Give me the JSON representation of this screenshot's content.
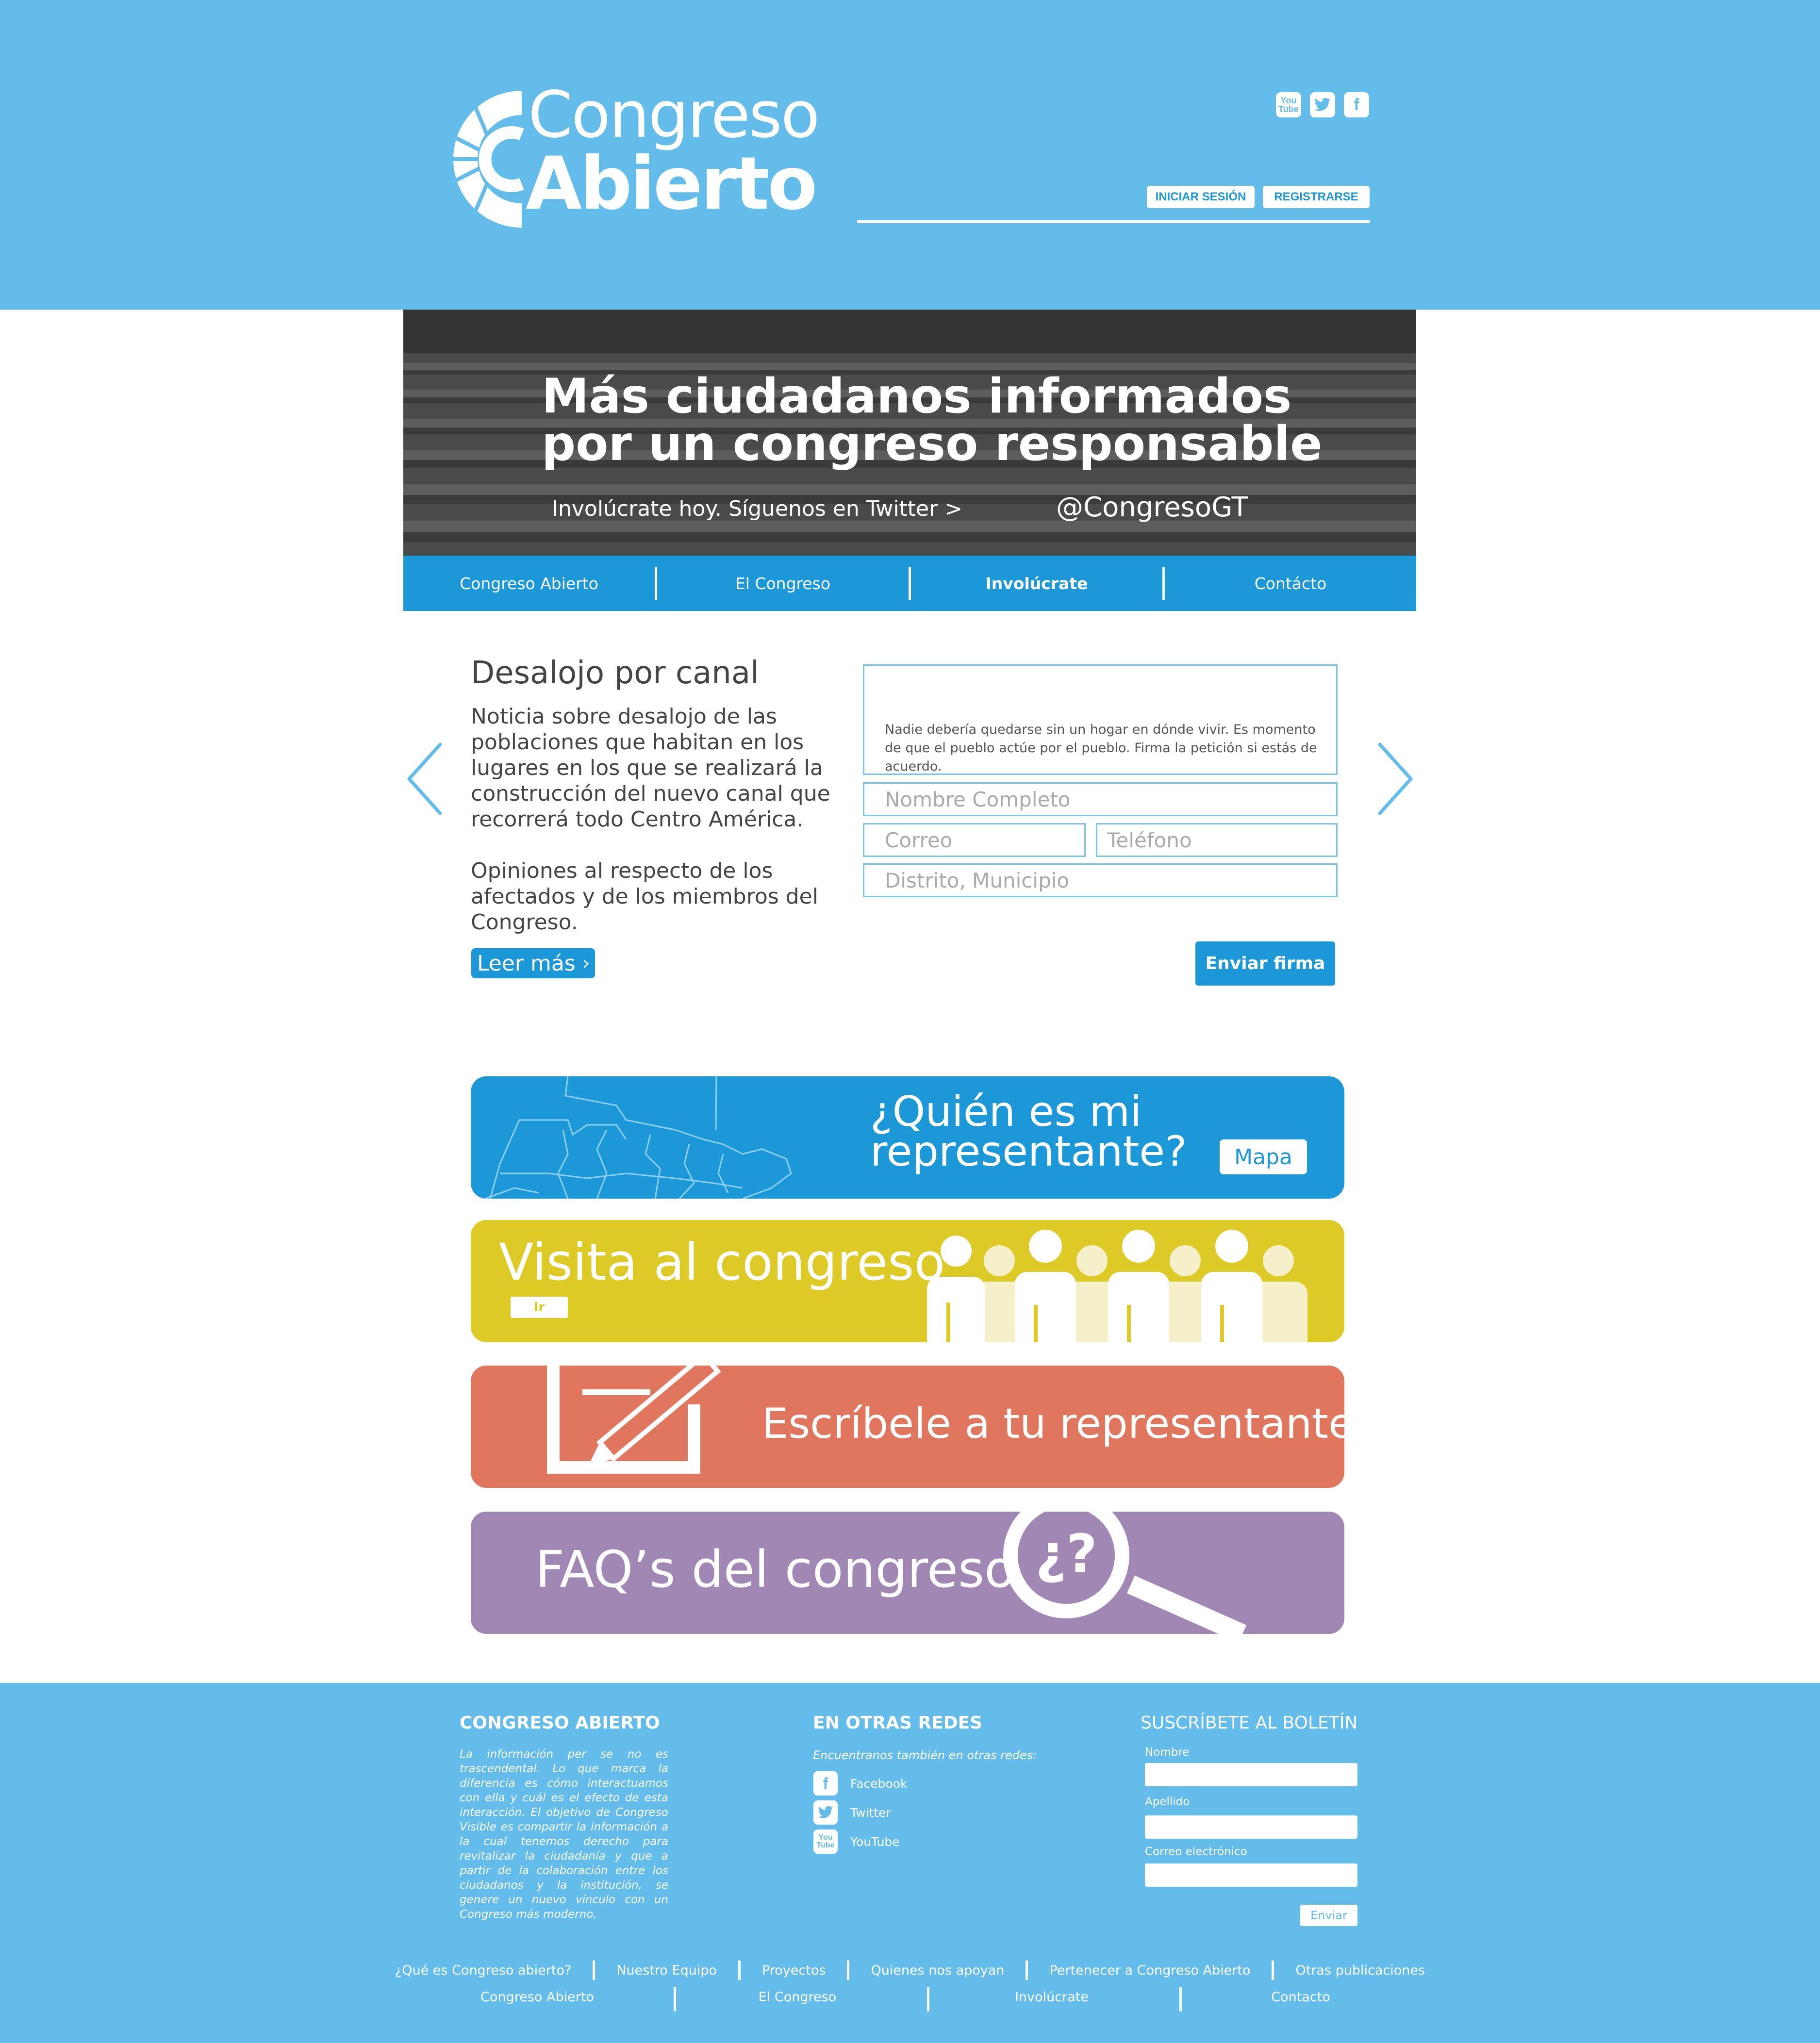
{
  "brand": {
    "line1": "Congreso",
    "line2": "Abierto"
  },
  "header": {
    "social_icons": [
      "youtube-icon",
      "twitter-icon",
      "facebook-icon"
    ],
    "login_label": "INICIAR SESIÓN",
    "register_label": "REGISTRARSE"
  },
  "hero": {
    "title_line1": "Más ciudadanos informados",
    "title_line2": "por un congreso responsable",
    "subtitle": "Involúcrate hoy. Síguenos en Twitter  >",
    "handle": "@CongresoGT"
  },
  "nav": {
    "items": [
      {
        "label": "Congreso Abierto"
      },
      {
        "label": "El Congreso"
      },
      {
        "label": "Involúcrate"
      },
      {
        "label": "Contácto"
      }
    ]
  },
  "article": {
    "title": "Desalojo por canal",
    "paragraph1": "Noticia sobre desalojo de las poblaciones que habitan en los lugares en los que se realizará la construcción del nuevo canal que recorrerá todo Centro América.",
    "paragraph2": "Opiniones al respecto de los afectados y de los miembros del Congreso.",
    "read_more": "Leer más"
  },
  "petition": {
    "text": "Nadie debería quedarse sin un hogar en dónde vivir. Es momento de que el pueblo actúe por el pueblo. Firma la petición si estás de acuerdo.",
    "placeholders": {
      "full_name": "Nombre Completo",
      "email": "Correo",
      "phone": "Teléfono",
      "district": "Distrito, Municipio"
    },
    "submit": "Enviar firma"
  },
  "banners": {
    "representative": {
      "title_line1": "¿Quién es mi",
      "title_line2": "representante?",
      "button": "Mapa"
    },
    "visit": {
      "title": "Visita al congreso",
      "button": "Ir"
    },
    "write": {
      "title": "Escríbele a tu representante"
    },
    "faq": {
      "title": "FAQ’s del congreso"
    }
  },
  "footer": {
    "about": {
      "heading": "CONGRESO ABIERTO",
      "text": "La información per se no es trascendental. Lo que marca la diferencia es cómo interactuamos con ella y cuál es el efecto de esta interacción. El objetivo de Congreso Visible es compartir la información a la cual tenemos derecho para revitalizar la ciudadanía y que a partir de la colaboración entre los ciudadanos y la institución, se genere un nuevo vínculo con un Congreso más moderno."
    },
    "networks": {
      "heading": "EN OTRAS REDES",
      "subtitle": "Encuentranos también en otras redes:",
      "items": [
        {
          "icon": "facebook-icon",
          "label": "Facebook"
        },
        {
          "icon": "twitter-icon",
          "label": "Twitter"
        },
        {
          "icon": "youtube-icon",
          "label": "YouTube"
        }
      ]
    },
    "newsletter": {
      "heading": "SUSCRÍBETE AL BOLETÍN",
      "name_label": "Nombre",
      "surname_label": "Apellido",
      "email_label": "Correo electrónico",
      "submit": "Enviar"
    },
    "links_row1": [
      "¿Qué es Congreso abierto?",
      "Nuestro Equipo",
      "Proyectos",
      "Quienes nos apoyan",
      "Pertenecer a Congreso Abierto",
      "Otras publicaciones"
    ],
    "links_row2": [
      "Congreso Abierto",
      "El Congreso",
      "Involúcrate",
      "Contacto"
    ]
  }
}
